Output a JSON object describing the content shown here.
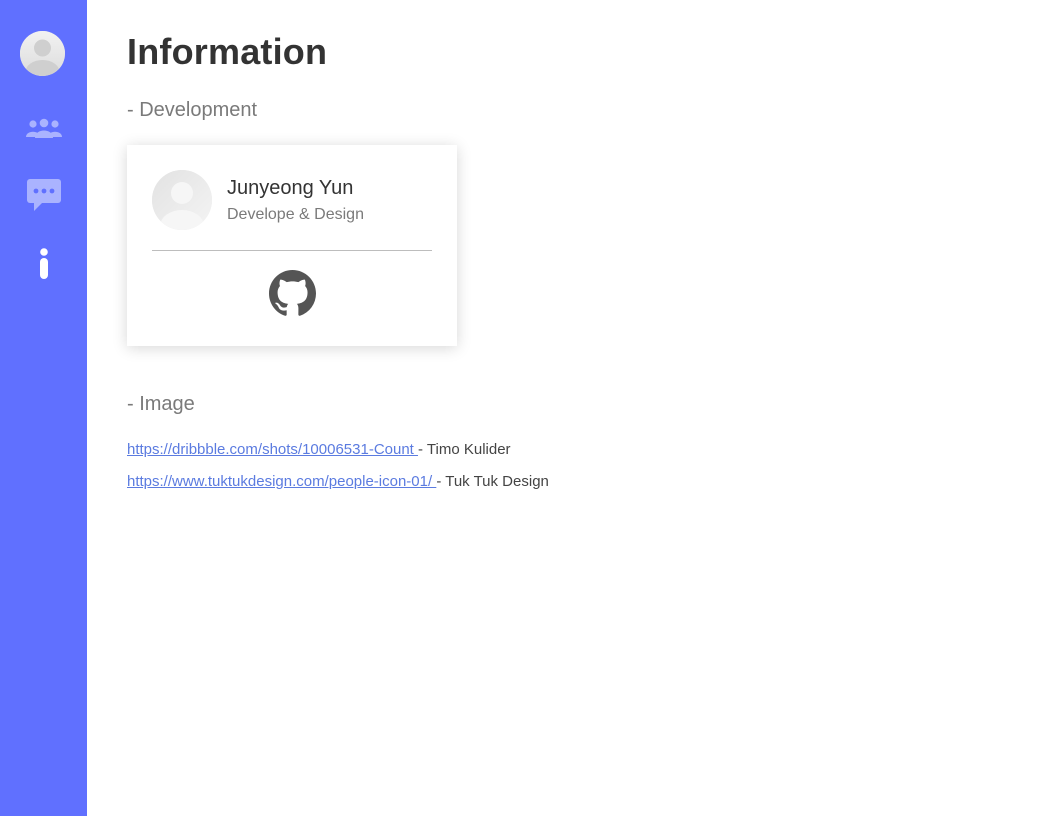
{
  "sidebar": {
    "items": [
      {
        "icon": "user-avatar-icon"
      },
      {
        "icon": "people-icon"
      },
      {
        "icon": "chat-bubble-icon"
      },
      {
        "icon": "info-icon"
      }
    ],
    "color": "#6070ff"
  },
  "page": {
    "title": "Information"
  },
  "development": {
    "heading": "- Development",
    "developer": {
      "name": "Junyeong Yun",
      "role": "Develope & Design",
      "link_icon": "github-icon"
    }
  },
  "image": {
    "heading": "- Image",
    "credits": [
      {
        "url": "https://dribbble.com/shots/10006531-Count ",
        "author": "- Timo Kulider"
      },
      {
        "url": "https://www.tuktukdesign.com/people-icon-01/ ",
        "author": "- Tuk Tuk Design"
      }
    ]
  },
  "colors": {
    "accent": "#6070ff",
    "link": "#5b7be0"
  }
}
